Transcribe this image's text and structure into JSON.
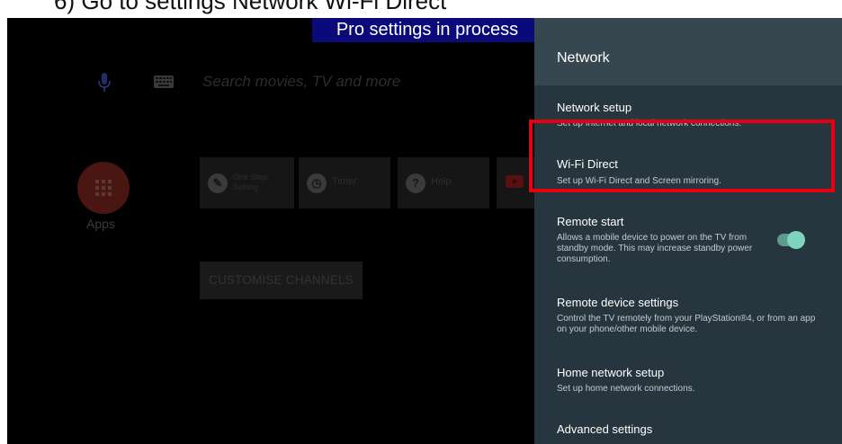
{
  "caption": "6) Go to settings Network Wi-Fi Direct",
  "banner": "Pro settings in process",
  "home": {
    "search_placeholder": "Search movies, TV and more",
    "apps_label": "Apps",
    "tiles": [
      {
        "label": "One Step Setting",
        "icon": "wrench-icon"
      },
      {
        "label": "Timer",
        "icon": "clock-icon"
      },
      {
        "label": "Help",
        "icon": "question-icon"
      },
      {
        "label": "",
        "icon": "youtube-icon"
      }
    ],
    "customise_label": "CUSTOMISE CHANNELS"
  },
  "panel": {
    "title": "Network",
    "items": [
      {
        "title": "Network setup",
        "desc": "Set up Internet and local network connections."
      },
      {
        "title": "Wi-Fi Direct",
        "desc": "Set up Wi-Fi Direct and Screen mirroring."
      },
      {
        "title": "Remote start",
        "desc": "Allows a mobile device to power on the TV from standby mode. This may increase standby power consumption.",
        "toggle_on": true
      },
      {
        "title": "Remote device settings",
        "desc": "Control the TV remotely from your PlayStation®4, or from an app on your phone/other mobile device."
      },
      {
        "title": "Home network setup",
        "desc": "Set up home network connections."
      },
      {
        "title": "Advanced settings",
        "desc": ""
      }
    ]
  },
  "colors": {
    "panel_bg": "#27363e",
    "panel_header": "#37474f",
    "highlight": "#e60012",
    "banner_bg": "#0a0a7a",
    "toggle_on": "#7fd4be"
  }
}
